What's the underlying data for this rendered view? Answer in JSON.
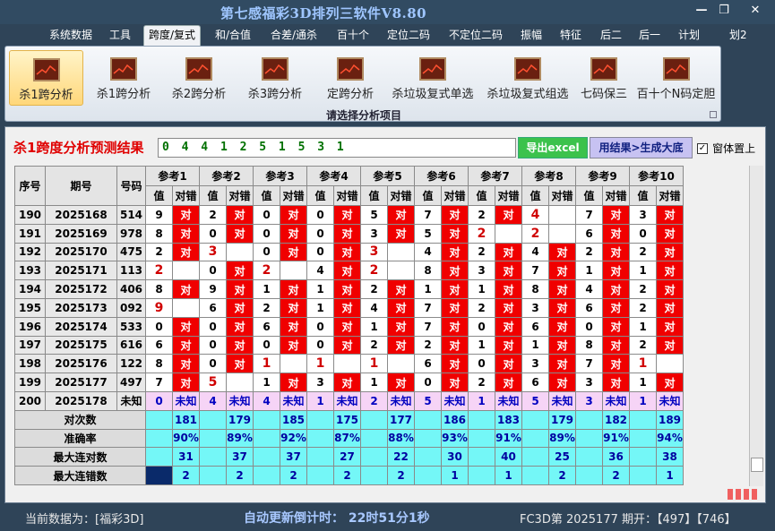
{
  "window": {
    "title": "第七感福彩3D排列三软件V8.80",
    "min": "—",
    "max": "❐",
    "close": "✕"
  },
  "menu": [
    "系统数据",
    "工具",
    "跨度/复式",
    "和/合值",
    "合差/通杀",
    "百十个",
    "定位二码",
    "不定位二码",
    "振幅",
    "特征",
    "后二",
    "后一",
    "计划",
    "划2"
  ],
  "menu_active": 2,
  "ribbon": {
    "buttons": [
      "杀1跨分析",
      "杀1跨分析",
      "杀2跨分析",
      "杀3跨分析",
      "定跨分析",
      "杀垃圾复式单选",
      "杀垃圾复式组选",
      "七码保三",
      "百十个N码定胆"
    ],
    "active": 0,
    "caption": "请选择分析项目"
  },
  "panel": {
    "title": "杀1跨度分析预测结果",
    "prediction": "0 4 4 1 2 5 1 5 3 1",
    "export_button": "导出excel",
    "generate_button": "用结果>生成大底",
    "on_top_label": "窗体置上",
    "on_top_checked": "✓"
  },
  "table": {
    "headers": {
      "seq": "序号",
      "period": "期号",
      "number": "号码"
    },
    "refs": [
      "参考1",
      "参考2",
      "参考3",
      "参考4",
      "参考5",
      "参考6",
      "参考7",
      "参考8",
      "参考9",
      "参考10"
    ],
    "sub_value": "值",
    "sub_check": "对错",
    "hit_text": "对",
    "rows": [
      {
        "seq": "190",
        "period": "2025168",
        "number": "514",
        "vals": [
          "9",
          "2",
          "0",
          "0",
          "5",
          "7",
          "2",
          "4",
          "7",
          "3"
        ],
        "hits": [
          1,
          1,
          1,
          1,
          1,
          1,
          1,
          0,
          1,
          1
        ]
      },
      {
        "seq": "191",
        "period": "2025169",
        "number": "978",
        "vals": [
          "8",
          "0",
          "0",
          "0",
          "3",
          "5",
          "2",
          "2",
          "6",
          "0"
        ],
        "hits": [
          1,
          1,
          1,
          1,
          1,
          1,
          0,
          0,
          1,
          1
        ]
      },
      {
        "seq": "192",
        "period": "2025170",
        "number": "475",
        "vals": [
          "2",
          "3",
          "0",
          "0",
          "3",
          "4",
          "2",
          "4",
          "2",
          "2"
        ],
        "hits": [
          1,
          0,
          1,
          1,
          0,
          1,
          1,
          1,
          1,
          1
        ]
      },
      {
        "seq": "193",
        "period": "2025171",
        "number": "113",
        "vals": [
          "2",
          "0",
          "2",
          "4",
          "2",
          "8",
          "3",
          "7",
          "1",
          "1"
        ],
        "hits": [
          0,
          1,
          0,
          1,
          0,
          1,
          1,
          1,
          1,
          1
        ]
      },
      {
        "seq": "194",
        "period": "2025172",
        "number": "406",
        "vals": [
          "8",
          "9",
          "1",
          "1",
          "2",
          "1",
          "1",
          "8",
          "4",
          "2"
        ],
        "hits": [
          1,
          1,
          1,
          1,
          1,
          1,
          1,
          1,
          1,
          1
        ]
      },
      {
        "seq": "195",
        "period": "2025173",
        "number": "092",
        "vals": [
          "9",
          "6",
          "2",
          "1",
          "4",
          "7",
          "2",
          "3",
          "6",
          "2"
        ],
        "hits": [
          0,
          1,
          1,
          1,
          1,
          1,
          1,
          1,
          1,
          1
        ]
      },
      {
        "seq": "196",
        "period": "2025174",
        "number": "533",
        "vals": [
          "0",
          "0",
          "6",
          "0",
          "1",
          "7",
          "0",
          "6",
          "0",
          "1"
        ],
        "hits": [
          1,
          1,
          1,
          1,
          1,
          1,
          1,
          1,
          1,
          1
        ]
      },
      {
        "seq": "197",
        "period": "2025175",
        "number": "616",
        "vals": [
          "6",
          "0",
          "0",
          "0",
          "2",
          "2",
          "1",
          "1",
          "8",
          "2"
        ],
        "hits": [
          1,
          1,
          1,
          1,
          1,
          1,
          1,
          1,
          1,
          1
        ]
      },
      {
        "seq": "198",
        "period": "2025176",
        "number": "122",
        "vals": [
          "8",
          "0",
          "1",
          "1",
          "1",
          "6",
          "0",
          "3",
          "7",
          "1"
        ],
        "hits": [
          1,
          1,
          0,
          0,
          0,
          1,
          1,
          1,
          1,
          0
        ]
      },
      {
        "seq": "199",
        "period": "2025177",
        "number": "497",
        "vals": [
          "7",
          "5",
          "1",
          "3",
          "1",
          "0",
          "2",
          "6",
          "3",
          "1"
        ],
        "hits": [
          1,
          0,
          1,
          1,
          1,
          1,
          1,
          1,
          1,
          1
        ]
      }
    ],
    "missed_cells": [
      [
        0,
        7
      ],
      [
        1,
        6
      ],
      [
        1,
        7
      ],
      [
        2,
        1
      ],
      [
        2,
        4
      ],
      [
        3,
        0
      ],
      [
        3,
        2
      ],
      [
        3,
        4
      ],
      [
        5,
        0
      ],
      [
        8,
        2
      ],
      [
        8,
        3
      ],
      [
        8,
        4
      ],
      [
        8,
        9
      ],
      [
        9,
        1
      ]
    ],
    "unknown_row": {
      "seq": "200",
      "period": "2025178",
      "number": "未知",
      "vals": [
        "0",
        "4",
        "4",
        "1",
        "2",
        "5",
        "1",
        "5",
        "3",
        "1"
      ],
      "label": "未知"
    },
    "stats": [
      {
        "label": "对次数",
        "values": [
          "181",
          "179",
          "185",
          "175",
          "177",
          "186",
          "183",
          "179",
          "182",
          "189"
        ]
      },
      {
        "label": "准确率",
        "values": [
          "90%",
          "89%",
          "92%",
          "87%",
          "88%",
          "93%",
          "91%",
          "89%",
          "91%",
          "94%"
        ]
      },
      {
        "label": "最大连对数",
        "values": [
          "31",
          "37",
          "37",
          "27",
          "22",
          "30",
          "40",
          "25",
          "36",
          "38"
        ]
      },
      {
        "label": "最大连错数",
        "values": [
          "2",
          "2",
          "2",
          "2",
          "2",
          "1",
          "1",
          "2",
          "2",
          "1"
        ]
      }
    ]
  },
  "status": {
    "current_data": "当前数据为：[福彩3D]",
    "countdown": "自动更新倒计时：  22时51分1秒",
    "issue": "FC3D第 2025177 期开：【497】【746】"
  },
  "colors": {
    "hit": "#f00000",
    "miss_text": "#d00000",
    "stat_bg": "#74f7f7",
    "unknown_bg": "#f6d4f6"
  }
}
